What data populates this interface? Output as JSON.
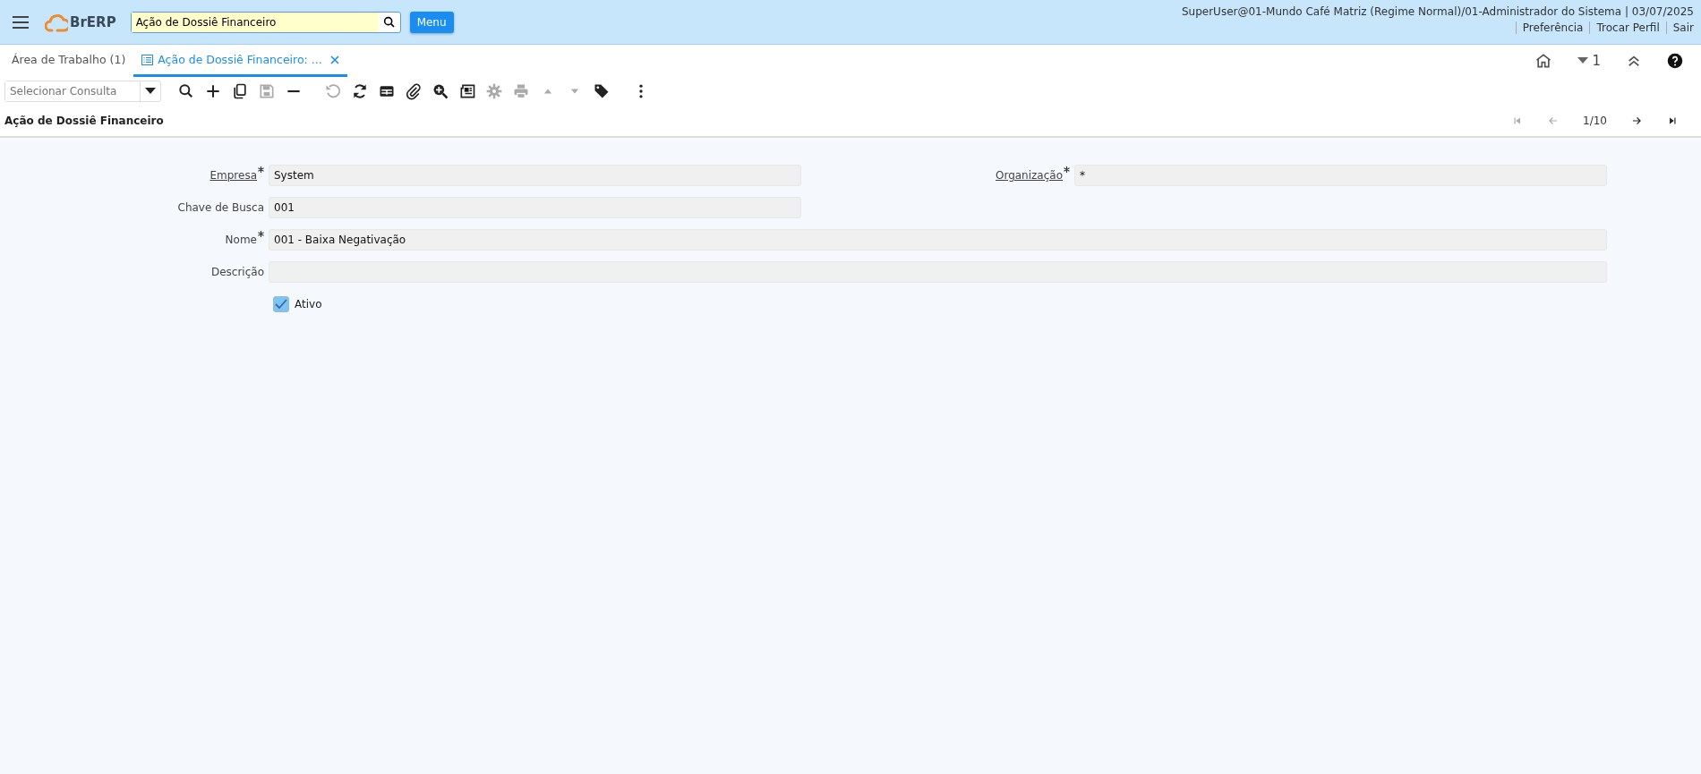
{
  "header": {
    "logo": "BrERP",
    "search": {
      "value": "Ação de Dossiê Financeiro"
    },
    "menu_button": "Menu",
    "user_info": "SuperUser@01-Mundo Café Matriz (Regime Normal)/01-Administrador do Sistema | 03/07/2025",
    "links": [
      "Preferência",
      "Trocar Perfil",
      "Sair"
    ]
  },
  "tabs": [
    {
      "label": "Área de Trabalho (1)",
      "selected": false,
      "closable": false
    },
    {
      "label": "Ação de Dossiê Financeiro: ...",
      "selected": true,
      "closable": true
    }
  ],
  "tab_tools": {
    "count": "1"
  },
  "toolbar": {
    "query": {
      "placeholder": "Selecionar Consulta"
    },
    "groups": [
      [
        {
          "kind": "search",
          "disabled": false
        },
        {
          "kind": "new",
          "disabled": false
        },
        {
          "kind": "copy",
          "disabled": false
        },
        {
          "kind": "save",
          "disabled": true
        },
        {
          "kind": "delete",
          "disabled": false
        }
      ],
      [
        {
          "kind": "undo",
          "disabled": true
        },
        {
          "kind": "refresh",
          "disabled": false
        },
        {
          "kind": "grid",
          "disabled": false
        },
        {
          "kind": "attach",
          "disabled": false
        },
        {
          "kind": "zoom",
          "disabled": false
        },
        {
          "kind": "report",
          "disabled": false
        },
        {
          "kind": "process",
          "disabled": true
        },
        {
          "kind": "print",
          "disabled": true
        },
        {
          "kind": "up",
          "disabled": true
        },
        {
          "kind": "down",
          "disabled": true
        },
        {
          "kind": "tag",
          "disabled": false
        }
      ],
      [
        {
          "kind": "more",
          "disabled": false
        }
      ]
    ]
  },
  "breadcrumb": {
    "title": "Ação de Dossiê Financeiro",
    "position": "1/10",
    "nav": [
      {
        "kind": "first",
        "disabled": true
      },
      {
        "kind": "prev",
        "disabled": true
      },
      {
        "kind": "next",
        "disabled": false
      },
      {
        "kind": "last",
        "disabled": false
      }
    ]
  },
  "form": {
    "rows": [
      [
        {
          "label": "Empresa",
          "required": true,
          "link": true,
          "value": "System",
          "wide": false
        },
        {
          "label": "Organização",
          "required": true,
          "link": true,
          "value": "*",
          "wide": false
        }
      ],
      [
        {
          "label": "Chave de Busca",
          "required": false,
          "link": false,
          "value": "001",
          "wide": false
        }
      ],
      [
        {
          "label": "Nome",
          "required": true,
          "link": false,
          "value": "001 - Baixa Negativação",
          "wide": true
        }
      ],
      [
        {
          "label": "Descrição",
          "required": false,
          "link": false,
          "wide": true
        }
      ]
    ],
    "checkbox": {
      "label": "Ativo",
      "checked": true
    }
  }
}
